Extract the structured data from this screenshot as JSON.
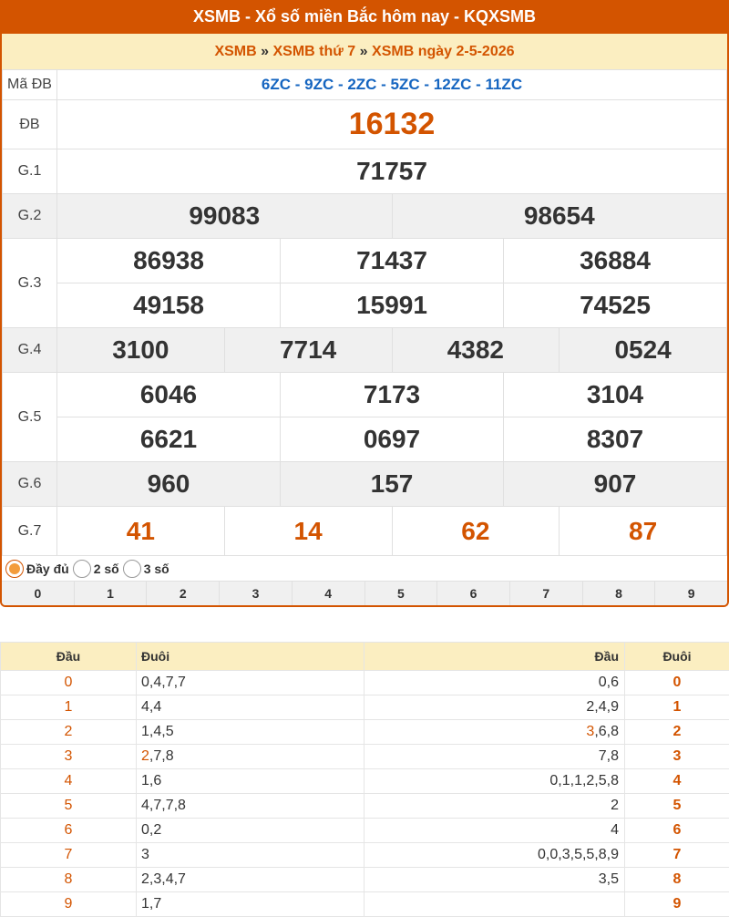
{
  "header": {
    "title": "XSMB - Xổ số miền Bắc hôm nay - KQXSMB"
  },
  "breadcrumb": {
    "item1": "XSMB",
    "sep": "»",
    "item2": "XSMB thứ 7",
    "item3": "XSMB ngày 2-5-2026"
  },
  "results": {
    "madb_label": "Mã ĐB",
    "madb_value": "6ZC - 9ZC - 2ZC - 5ZC - 12ZC - 11ZC",
    "db_label": "ĐB",
    "db": "16132",
    "g1_label": "G.1",
    "g1": "71757",
    "g2_label": "G.2",
    "g2": [
      "99083",
      "98654"
    ],
    "g3_label": "G.3",
    "g3": [
      "86938",
      "71437",
      "36884",
      "49158",
      "15991",
      "74525"
    ],
    "g4_label": "G.4",
    "g4": [
      "3100",
      "7714",
      "4382",
      "0524"
    ],
    "g5_label": "G.5",
    "g5": [
      "6046",
      "7173",
      "3104",
      "6621",
      "0697",
      "8307"
    ],
    "g6_label": "G.6",
    "g6": [
      "960",
      "157",
      "907"
    ],
    "g7_label": "G.7",
    "g7": [
      "41",
      "14",
      "62",
      "87"
    ]
  },
  "display_options": {
    "full": "Đầy đủ",
    "two": "2 số",
    "three": "3 số",
    "selected": "full"
  },
  "digit_filter": [
    "0",
    "1",
    "2",
    "3",
    "4",
    "5",
    "6",
    "7",
    "8",
    "9"
  ],
  "loto": {
    "headers": {
      "dau": "Đầu",
      "duoi": "Đuôi",
      "dau2": "Đầu",
      "duoi2": "Đuôi"
    },
    "rows": [
      {
        "d": "0",
        "tails": "0,4,7,7",
        "heads": "0,6",
        "t": "0"
      },
      {
        "d": "1",
        "tails": "4,4",
        "heads": "2,4,9",
        "t": "1"
      },
      {
        "d": "2",
        "tails": "1,4,5",
        "heads_hl": "3",
        "heads": ",6,8",
        "t": "2"
      },
      {
        "d": "3",
        "tails_hl": "2",
        "tails": ",7,8",
        "heads": "7,8",
        "t": "3"
      },
      {
        "d": "4",
        "tails": "1,6",
        "heads": "0,1,1,2,5,8",
        "t": "4"
      },
      {
        "d": "5",
        "tails": "4,7,7,8",
        "heads": "2",
        "t": "5"
      },
      {
        "d": "6",
        "tails": "0,2",
        "heads": "4",
        "t": "6"
      },
      {
        "d": "7",
        "tails": "3",
        "heads": "0,0,3,5,5,8,9",
        "t": "7"
      },
      {
        "d": "8",
        "tails": "2,3,4,7",
        "heads": "3,5",
        "t": "8"
      },
      {
        "d": "9",
        "tails": "1,7",
        "heads": "",
        "t": "9"
      }
    ]
  }
}
